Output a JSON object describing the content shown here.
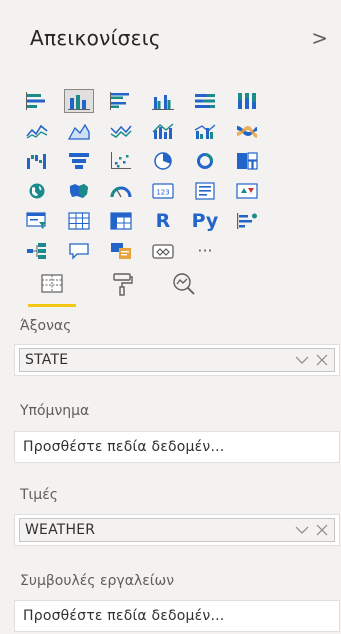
{
  "pane": {
    "title": "Απεικονίσεις",
    "collapse_glyph": ">"
  },
  "gallery": {
    "icons": [
      "stacked-bar-chart-icon",
      "stacked-column-chart-icon",
      "clustered-bar-chart-icon",
      "clustered-column-chart-icon",
      "100-stacked-bar-chart-icon",
      "100-stacked-column-chart-icon",
      "line-chart-icon",
      "area-chart-icon",
      "stacked-area-chart-icon",
      "line-and-stacked-column-chart-icon",
      "line-and-clustered-column-chart-icon",
      "ribbon-chart-icon",
      "waterfall-chart-icon",
      "funnel-chart-icon",
      "scatter-chart-icon",
      "pie-chart-icon",
      "donut-chart-icon",
      "treemap-icon",
      "map-icon",
      "filled-map-icon",
      "gauge-icon",
      "card-icon",
      "multi-row-card-icon",
      "kpi-icon",
      "slicer-icon",
      "table-icon",
      "matrix-icon",
      "r-script-visual-icon",
      "python-visual-icon",
      "key-influencers-icon",
      "decomposition-tree-icon",
      "q-and-a-icon",
      "smart-narrative-icon",
      "paginated-report-icon",
      "more-visuals-icon"
    ],
    "card_text": "123",
    "r_text": "R",
    "py_text": "Py",
    "more_text": "···"
  },
  "tabs": [
    "fields-tab-icon",
    "format-tab-icon",
    "analytics-tab-icon"
  ],
  "wells": {
    "axis_label": "Άξονας",
    "axis_field": "STATE",
    "legend_label": "Υπόμνημα",
    "legend_placeholder": "Προσθέστε πεδία δεδομέν...",
    "values_label": "Τιμές",
    "values_field": "WEATHER",
    "tooltips_label": "Συμβουλές εργαλείων",
    "tooltips_placeholder": "Προσθέστε πεδία δεδομέν..."
  },
  "colors": {
    "accent_yellow": "#f2c811",
    "icon_blue": "#2264c7",
    "icon_teal": "#1a8a8a",
    "icon_gray": "#605e5c"
  }
}
